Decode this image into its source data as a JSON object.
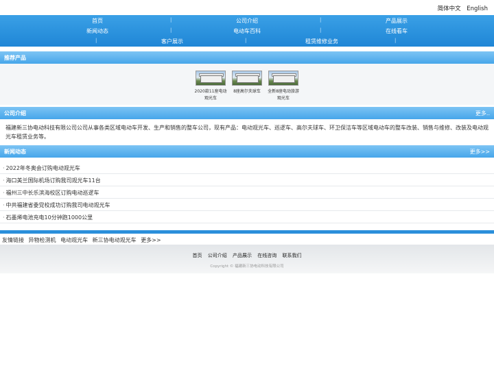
{
  "lang": {
    "zh": "简体中文",
    "en": "English"
  },
  "nav": {
    "row1": [
      "首页",
      "公司介绍",
      "产品展示"
    ],
    "row2": [
      "新闻动态",
      "电动车百科",
      "在线看车"
    ],
    "row3": [
      "客户展示",
      "租赁维修业务"
    ],
    "sep": "|"
  },
  "products": {
    "title": "推荐产品",
    "items": [
      {
        "name": "2020款11座电动观光车"
      },
      {
        "name": "8座高尔夫球车"
      },
      {
        "name": "全新8座电动旅游观光车"
      }
    ]
  },
  "about": {
    "title": "公司介绍",
    "more": "更多..",
    "text": "福建新三协电动科技有限公司公司从事各类区域电动车开发、生产和销售的整车公司，现有产品：电动观光车、巡逻车、高尔夫球车、环卫保洁车等区域电动车的整车改装、销售与维修、改装及电动观光车租赁业务等。"
  },
  "news": {
    "title": "新闻动态",
    "more": "更多>>",
    "bullet": "·",
    "items": [
      "2022年冬奥会订购电动观光车",
      "海口美兰国际机场订购我司观光车11台",
      "福州三中长乐滨海校区订购电动巡逻车",
      "中共福建省委党校成功订购我司电动观光车",
      "石墨烯电池充电10分钟跑1000公里"
    ]
  },
  "links": [
    "友情链接",
    "异物检测机",
    "电动观光车",
    "新三协电动观光车",
    "更多>>"
  ],
  "footer": {
    "nav": [
      "首页",
      "公司介绍",
      "产品展示",
      "在线咨询",
      "联系我们"
    ],
    "copyright": "Copyright © 福建新三协电动科技有限公司"
  },
  "colors": {
    "nav": "#1f86d6",
    "bar": "#46a6ea",
    "strip": "#2b8fdb"
  }
}
